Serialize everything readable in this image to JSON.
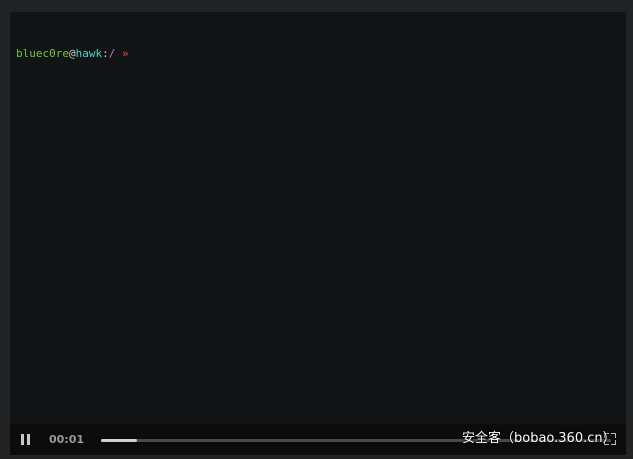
{
  "terminal": {
    "prompt": {
      "user": "bluec0re",
      "at": "@",
      "host": "hawk",
      "colon": ":",
      "path": "/",
      "arrow": "»"
    }
  },
  "player": {
    "time": "00:01",
    "progress": 0.07,
    "play_state_icon": "pause-icon",
    "fullscreen_icon": "fullscreen-icon"
  },
  "watermark": {
    "text": "安全客（bobao.360.cn）"
  },
  "colors": {
    "background": "#222324",
    "terminal_bg": "#131415",
    "controls_bg": "#0c0c0d",
    "user": "#6cc644",
    "host": "#4fd1c5",
    "path": "#b07dd6",
    "arrow": "#e5484d"
  }
}
